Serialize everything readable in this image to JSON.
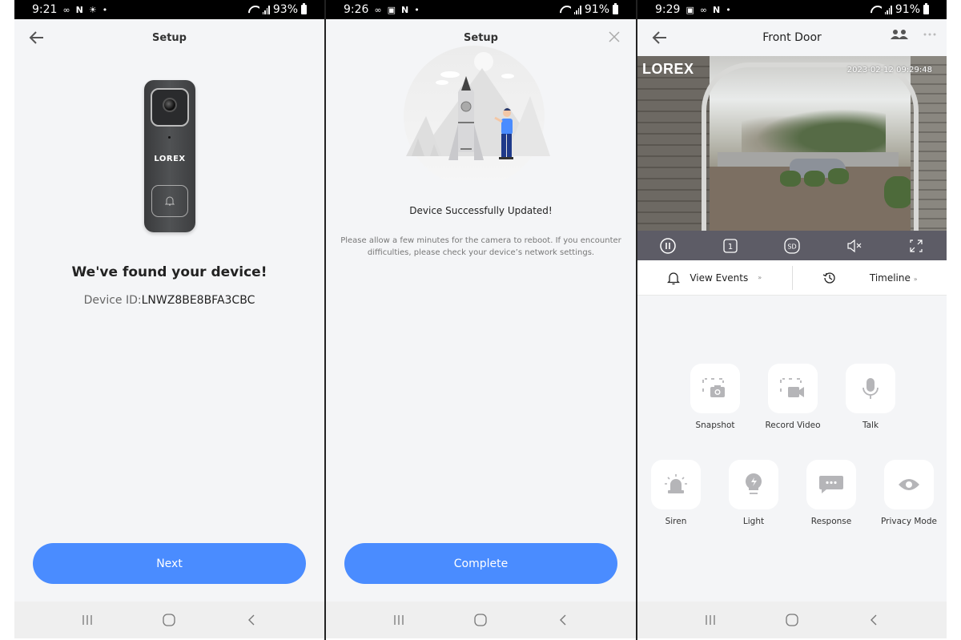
{
  "panels": [
    {
      "status": {
        "time": "9:21",
        "icons_left": [
          "voicemail-icon",
          "n-icon",
          "weather-icon",
          "dot"
        ],
        "battery": "93%"
      },
      "appbar": {
        "title": "Setup"
      },
      "device_brand": "LOREX",
      "heading": "We've found your device!",
      "device_id_label": "Device ID:",
      "device_id_value": "LNWZ8BE8BFA3CBC",
      "primary_button": "Next"
    },
    {
      "status": {
        "time": "9:26",
        "icons_left": [
          "voicemail-icon",
          "image-icon",
          "n-icon",
          "dot"
        ],
        "battery": "91%"
      },
      "appbar": {
        "title": "Setup"
      },
      "heading": "Device Successfully Updated!",
      "description": "Please allow a few minutes for the camera to reboot. If you encounter difficulties, please check your device’s network settings.",
      "primary_button": "Complete"
    },
    {
      "status": {
        "time": "9:29",
        "icons_left": [
          "image-icon",
          "voicemail-icon",
          "n-icon",
          "dot"
        ],
        "battery": "91%"
      },
      "appbar": {
        "title": "Front Door"
      },
      "video": {
        "logo": "LOREX",
        "timestamp": "2023-02-12 09:29:48"
      },
      "controls": [
        "pause-icon",
        "channel-1-icon",
        "sd-quality-icon",
        "mute-icon",
        "fullscreen-icon"
      ],
      "control_labels": {
        "channel": "1",
        "quality": "SD"
      },
      "events_row": {
        "view_events": "View Events",
        "timeline": "Timeline"
      },
      "actions_row1": [
        {
          "label": "Snapshot",
          "icon": "snapshot-icon"
        },
        {
          "label": "Record Video",
          "icon": "record-video-icon"
        },
        {
          "label": "Talk",
          "icon": "microphone-icon"
        }
      ],
      "actions_row2": [
        {
          "label": "Siren",
          "icon": "siren-icon"
        },
        {
          "label": "Light",
          "icon": "light-bulb-icon"
        },
        {
          "label": "Response",
          "icon": "chat-bubble-icon"
        },
        {
          "label": "Privacy Mode",
          "icon": "eye-icon"
        }
      ]
    }
  ],
  "colors": {
    "accent": "#4a8cff",
    "control_bar": "#5d5c66",
    "background": "#f4f5f7",
    "icon_gray": "#b5b5b8"
  }
}
